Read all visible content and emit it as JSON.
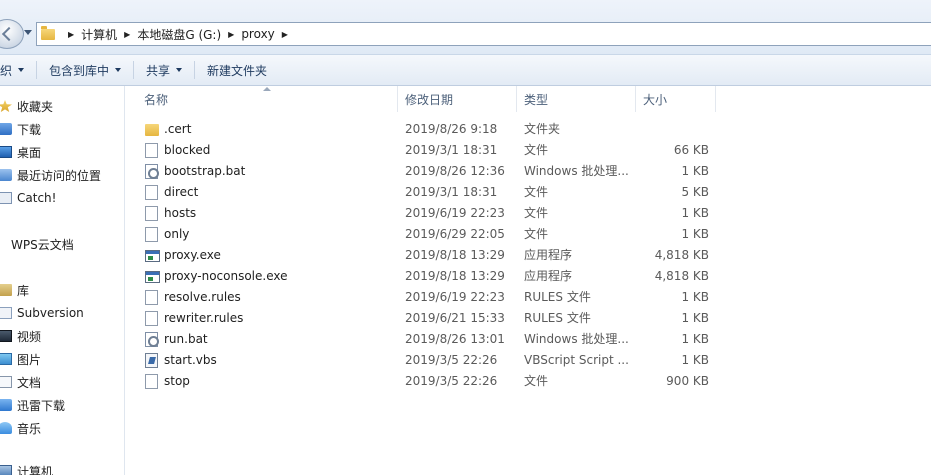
{
  "address": {
    "crumbs": [
      "计算机",
      "本地磁盘G (G:)",
      "proxy"
    ]
  },
  "toolbar": {
    "organize_label": "织",
    "include_label": "包含到库中",
    "share_label": "共享",
    "new_folder_label": "新建文件夹"
  },
  "nav": {
    "favorites_label": "收藏夹",
    "downloads_label": "下载",
    "desktop_label": "桌面",
    "recent_label": "最近访问的位置",
    "catch_label": "Catch!",
    "wps_label": "WPS云文档",
    "libraries_label": "库",
    "subversion_label": "Subversion",
    "video_label": "视频",
    "pictures_label": "图片",
    "documents_label": "文档",
    "xunlei_label": "迅雷下载",
    "music_label": "音乐",
    "computer_label": "计算机"
  },
  "columns": {
    "name": "名称",
    "date": "修改日期",
    "type": "类型",
    "size": "大小"
  },
  "files": [
    {
      "name": ".cert",
      "date": "2019/8/26 9:18",
      "type": "文件夹",
      "size": "",
      "icon": "folder-icon"
    },
    {
      "name": "blocked",
      "date": "2019/3/1 18:31",
      "type": "文件",
      "size": "66 KB",
      "icon": "file-icon"
    },
    {
      "name": "bootstrap.bat",
      "date": "2019/8/26 12:36",
      "type": "Windows 批处理...",
      "size": "1 KB",
      "icon": "batch-gear-icon"
    },
    {
      "name": "direct",
      "date": "2019/3/1 18:31",
      "type": "文件",
      "size": "5 KB",
      "icon": "file-icon"
    },
    {
      "name": "hosts",
      "date": "2019/6/19 22:23",
      "type": "文件",
      "size": "1 KB",
      "icon": "file-icon"
    },
    {
      "name": "only",
      "date": "2019/6/29 22:05",
      "type": "文件",
      "size": "1 KB",
      "icon": "file-icon"
    },
    {
      "name": "proxy.exe",
      "date": "2019/8/18 13:29",
      "type": "应用程序",
      "size": "4,818 KB",
      "icon": "exe-icon"
    },
    {
      "name": "proxy-noconsole.exe",
      "date": "2019/8/18 13:29",
      "type": "应用程序",
      "size": "4,818 KB",
      "icon": "exe-icon"
    },
    {
      "name": "resolve.rules",
      "date": "2019/6/19 22:23",
      "type": "RULES 文件",
      "size": "1 KB",
      "icon": "file-icon"
    },
    {
      "name": "rewriter.rules",
      "date": "2019/6/21 15:33",
      "type": "RULES 文件",
      "size": "1 KB",
      "icon": "file-icon"
    },
    {
      "name": "run.bat",
      "date": "2019/8/26 13:01",
      "type": "Windows 批处理...",
      "size": "1 KB",
      "icon": "batch-gear-icon"
    },
    {
      "name": "start.vbs",
      "date": "2019/3/5 22:26",
      "type": "VBScript Script ...",
      "size": "1 KB",
      "icon": "vbs-script-icon"
    },
    {
      "name": "stop",
      "date": "2019/3/5 22:26",
      "type": "文件",
      "size": "900 KB",
      "icon": "file-icon"
    }
  ]
}
